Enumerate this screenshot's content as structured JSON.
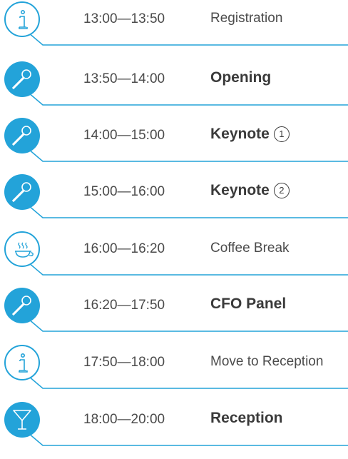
{
  "colors": {
    "accent": "#23a3d9",
    "text": "#4b4b4b",
    "line": "#23a3d9"
  },
  "schedule": [
    {
      "time": "13:00—13:50",
      "title": "Registration",
      "icon": "info-icon",
      "style": "regular"
    },
    {
      "time": "13:50—14:00",
      "title": "Opening",
      "icon": "microphone-icon",
      "style": "bold"
    },
    {
      "time": "14:00—15:00",
      "title": "Keynote",
      "badge": "1",
      "icon": "microphone-icon",
      "style": "bold"
    },
    {
      "time": "15:00—16:00",
      "title": "Keynote",
      "badge": "2",
      "icon": "microphone-icon",
      "style": "bold"
    },
    {
      "time": "16:00—16:20",
      "title": "Coffee Break",
      "icon": "coffee-cup-icon",
      "style": "regular"
    },
    {
      "time": "16:20—17:50",
      "title": "CFO Panel",
      "icon": "microphone-icon",
      "style": "bold"
    },
    {
      "time": "17:50—18:00",
      "title": "Move to Reception",
      "icon": "info-icon",
      "style": "regular"
    },
    {
      "time": "18:00—20:00",
      "title": "Reception",
      "icon": "cocktail-icon",
      "style": "bold"
    }
  ]
}
